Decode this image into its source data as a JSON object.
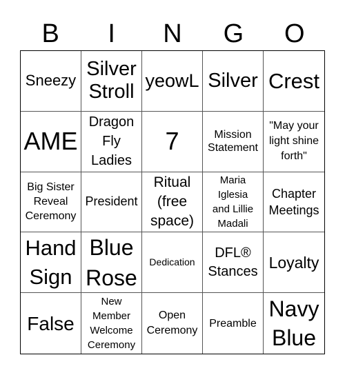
{
  "header": {
    "letters": [
      "B",
      "I",
      "N",
      "G",
      "O"
    ]
  },
  "cells": [
    "Sneezy",
    "Silver\nStroll",
    "yeowL",
    "Silver",
    "Crest",
    "AME",
    "Dragon\nFly\nLadies",
    "7",
    "Mission\nStatement",
    "\"May your\nlight shine\nforth\"",
    "Big Sister\nReveal\nCeremony",
    "President",
    "Ritual\n(free\nspace)",
    "Maria\nIglesia\nand Lillie\nMadali",
    "Chapter\nMeetings",
    "Hand\nSign",
    "Blue\nRose",
    "Dedication",
    "DFL®\nStances",
    "Loyalty",
    "False",
    "New\nMember\nWelcome\nCeremony",
    "Open\nCeremony",
    "Preamble",
    "Navy\nBlue"
  ]
}
